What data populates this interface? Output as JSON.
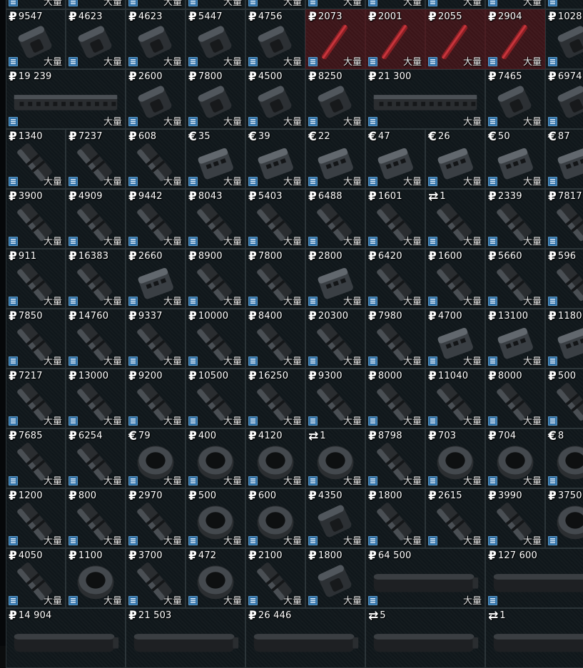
{
  "screen": {
    "title": "",
    "quantity_label": "大量"
  },
  "colors": {
    "cell_background": "#10171b",
    "cell_border": "#2b3438",
    "special_cell_background": "#3b1418",
    "tag_blue": "#2f6fa6",
    "text": "#ffffff"
  },
  "offers": [
    {
      "row": 0,
      "col": 0,
      "span": 1,
      "currency": "",
      "price": "",
      "icon": "tag",
      "art": "gear"
    },
    {
      "row": 0,
      "col": 1,
      "span": 1,
      "currency": "",
      "price": "",
      "icon": "tag",
      "art": "gear"
    },
    {
      "row": 0,
      "col": 2,
      "span": 1,
      "currency": "",
      "price": "",
      "icon": "tag",
      "art": "gear"
    },
    {
      "row": 0,
      "col": 3,
      "span": 1,
      "currency": "",
      "price": "",
      "icon": "tag",
      "art": "gear"
    },
    {
      "row": 0,
      "col": 4,
      "span": 1,
      "currency": "",
      "price": "",
      "icon": "tag",
      "art": "gear"
    },
    {
      "row": 0,
      "col": 5,
      "span": 1,
      "currency": "",
      "price": "",
      "icon": "tag",
      "art": "gear"
    },
    {
      "row": 0,
      "col": 6,
      "span": 1,
      "currency": "",
      "price": "",
      "icon": "tag",
      "art": "gear"
    },
    {
      "row": 0,
      "col": 7,
      "span": 1,
      "currency": "",
      "price": "",
      "icon": "tag",
      "art": "gear"
    },
    {
      "row": 0,
      "col": 8,
      "span": 1,
      "currency": "",
      "price": "",
      "icon": "tag",
      "art": "gear"
    },
    {
      "row": 0,
      "col": 9,
      "span": 1,
      "currency": "",
      "price": "",
      "icon": "tag",
      "art": "gear"
    },
    {
      "row": 1,
      "col": 0,
      "span": 1,
      "currency": "₽",
      "price": "9547",
      "icon": "tag",
      "art": "gear"
    },
    {
      "row": 1,
      "col": 1,
      "span": 1,
      "currency": "₽",
      "price": "4623",
      "icon": "tag",
      "art": "gear"
    },
    {
      "row": 1,
      "col": 2,
      "span": 1,
      "currency": "₽",
      "price": "4623",
      "icon": "tag",
      "art": "gear"
    },
    {
      "row": 1,
      "col": 3,
      "span": 1,
      "currency": "₽",
      "price": "5447",
      "icon": "tag",
      "art": "gear"
    },
    {
      "row": 1,
      "col": 4,
      "span": 1,
      "currency": "₽",
      "price": "4756",
      "icon": "tag",
      "art": "gear"
    },
    {
      "row": 1,
      "col": 5,
      "span": 1,
      "currency": "₽",
      "price": "2073",
      "icon": "tag",
      "art": "red",
      "variant": "red"
    },
    {
      "row": 1,
      "col": 6,
      "span": 1,
      "currency": "₽",
      "price": "2001",
      "icon": "tag",
      "art": "red",
      "variant": "red"
    },
    {
      "row": 1,
      "col": 7,
      "span": 1,
      "currency": "₽",
      "price": "2055",
      "icon": "tag",
      "art": "red",
      "variant": "red"
    },
    {
      "row": 1,
      "col": 8,
      "span": 1,
      "currency": "₽",
      "price": "2904",
      "icon": "tag",
      "art": "red",
      "variant": "red"
    },
    {
      "row": 1,
      "col": 9,
      "span": 1,
      "currency": "₽",
      "price": "1028",
      "icon": "tag",
      "art": "gear"
    },
    {
      "row": 2,
      "col": 0,
      "span": 2,
      "currency": "₽",
      "price": "19 239",
      "icon": "tag",
      "art": "handguard"
    },
    {
      "row": 2,
      "col": 2,
      "span": 1,
      "currency": "₽",
      "price": "2600",
      "icon": "tag",
      "art": "gear"
    },
    {
      "row": 2,
      "col": 3,
      "span": 1,
      "currency": "₽",
      "price": "7800",
      "icon": "tag",
      "art": "gear"
    },
    {
      "row": 2,
      "col": 4,
      "span": 1,
      "currency": "₽",
      "price": "4500",
      "icon": "tag",
      "art": "gear"
    },
    {
      "row": 2,
      "col": 5,
      "span": 1,
      "currency": "₽",
      "price": "8250",
      "icon": "tag",
      "art": "gear"
    },
    {
      "row": 2,
      "col": 6,
      "span": 2,
      "currency": "₽",
      "price": "21 300",
      "icon": "tag",
      "art": "handguard"
    },
    {
      "row": 2,
      "col": 8,
      "span": 1,
      "currency": "₽",
      "price": "7465",
      "icon": "tag",
      "art": "gear"
    },
    {
      "row": 2,
      "col": 9,
      "span": 1,
      "currency": "₽",
      "price": "6974",
      "icon": "tag",
      "art": "gear"
    },
    {
      "row": 3,
      "col": 0,
      "span": 1,
      "currency": "₽",
      "price": "1340",
      "icon": "tag",
      "art": "muzzle"
    },
    {
      "row": 3,
      "col": 1,
      "span": 1,
      "currency": "₽",
      "price": "7237",
      "icon": "tag",
      "art": "muzzle"
    },
    {
      "row": 3,
      "col": 2,
      "span": 1,
      "currency": "₽",
      "price": "608",
      "icon": "tag",
      "art": "muzzle"
    },
    {
      "row": 3,
      "col": 3,
      "span": 1,
      "currency": "€",
      "price": "35",
      "icon": "tag",
      "art": "comp"
    },
    {
      "row": 3,
      "col": 4,
      "span": 1,
      "currency": "€",
      "price": "39",
      "icon": "tag",
      "art": "comp"
    },
    {
      "row": 3,
      "col": 5,
      "span": 1,
      "currency": "€",
      "price": "22",
      "icon": "tag",
      "art": "comp"
    },
    {
      "row": 3,
      "col": 6,
      "span": 1,
      "currency": "€",
      "price": "47",
      "icon": "tag",
      "art": "comp"
    },
    {
      "row": 3,
      "col": 7,
      "span": 1,
      "currency": "€",
      "price": "26",
      "icon": "tag",
      "art": "comp"
    },
    {
      "row": 3,
      "col": 8,
      "span": 1,
      "currency": "€",
      "price": "50",
      "icon": "tag",
      "art": "comp"
    },
    {
      "row": 3,
      "col": 9,
      "span": 1,
      "currency": "€",
      "price": "87",
      "icon": "tag",
      "art": "comp"
    },
    {
      "row": 4,
      "col": 0,
      "span": 1,
      "currency": "₽",
      "price": "3900",
      "icon": "tag",
      "art": "muzzle"
    },
    {
      "row": 4,
      "col": 1,
      "span": 1,
      "currency": "₽",
      "price": "4909",
      "icon": "tag",
      "art": "muzzle"
    },
    {
      "row": 4,
      "col": 2,
      "span": 1,
      "currency": "₽",
      "price": "9442",
      "icon": "tag",
      "art": "muzzle"
    },
    {
      "row": 4,
      "col": 3,
      "span": 1,
      "currency": "₽",
      "price": "8043",
      "icon": "tag",
      "art": "muzzle"
    },
    {
      "row": 4,
      "col": 4,
      "span": 1,
      "currency": "₽",
      "price": "5403",
      "icon": "tag",
      "art": "muzzle"
    },
    {
      "row": 4,
      "col": 5,
      "span": 1,
      "currency": "₽",
      "price": "6488",
      "icon": "tag",
      "art": "muzzle"
    },
    {
      "row": 4,
      "col": 6,
      "span": 1,
      "currency": "₽",
      "price": "1601",
      "icon": "tag",
      "art": "muzzle"
    },
    {
      "row": 4,
      "col": 7,
      "span": 1,
      "currency": "⇄",
      "price": "1",
      "icon": "tag",
      "art": "muzzle"
    },
    {
      "row": 4,
      "col": 8,
      "span": 1,
      "currency": "₽",
      "price": "2339",
      "icon": "tag",
      "art": "muzzle"
    },
    {
      "row": 4,
      "col": 9,
      "span": 1,
      "currency": "₽",
      "price": "7817",
      "icon": "tag",
      "art": "muzzle"
    },
    {
      "row": 5,
      "col": 0,
      "span": 1,
      "currency": "₽",
      "price": "911",
      "icon": "tag",
      "art": "muzzle"
    },
    {
      "row": 5,
      "col": 1,
      "span": 1,
      "currency": "₽",
      "price": "16383",
      "icon": "tag",
      "art": "muzzle"
    },
    {
      "row": 5,
      "col": 2,
      "span": 1,
      "currency": "₽",
      "price": "2660",
      "icon": "tag",
      "art": "comp"
    },
    {
      "row": 5,
      "col": 3,
      "span": 1,
      "currency": "₽",
      "price": "8900",
      "icon": "tag",
      "art": "muzzle"
    },
    {
      "row": 5,
      "col": 4,
      "span": 1,
      "currency": "₽",
      "price": "7800",
      "icon": "tag",
      "art": "muzzle"
    },
    {
      "row": 5,
      "col": 5,
      "span": 1,
      "currency": "₽",
      "price": "2800",
      "icon": "tag",
      "art": "comp"
    },
    {
      "row": 5,
      "col": 6,
      "span": 1,
      "currency": "₽",
      "price": "6420",
      "icon": "tag",
      "art": "muzzle"
    },
    {
      "row": 5,
      "col": 7,
      "span": 1,
      "currency": "₽",
      "price": "1600",
      "icon": "tag",
      "art": "muzzle"
    },
    {
      "row": 5,
      "col": 8,
      "span": 1,
      "currency": "₽",
      "price": "5660",
      "icon": "tag",
      "art": "muzzle"
    },
    {
      "row": 5,
      "col": 9,
      "span": 1,
      "currency": "₽",
      "price": "596",
      "icon": "tag",
      "art": "muzzle"
    },
    {
      "row": 6,
      "col": 0,
      "span": 1,
      "currency": "₽",
      "price": "7850",
      "icon": "tag",
      "art": "muzzle"
    },
    {
      "row": 6,
      "col": 1,
      "span": 1,
      "currency": "₽",
      "price": "14760",
      "icon": "tag",
      "art": "muzzle"
    },
    {
      "row": 6,
      "col": 2,
      "span": 1,
      "currency": "₽",
      "price": "9337",
      "icon": "tag",
      "art": "muzzle"
    },
    {
      "row": 6,
      "col": 3,
      "span": 1,
      "currency": "₽",
      "price": "10000",
      "icon": "tag",
      "art": "muzzle"
    },
    {
      "row": 6,
      "col": 4,
      "span": 1,
      "currency": "₽",
      "price": "8400",
      "icon": "tag",
      "art": "muzzle"
    },
    {
      "row": 6,
      "col": 5,
      "span": 1,
      "currency": "₽",
      "price": "20300",
      "icon": "tag",
      "art": "muzzle"
    },
    {
      "row": 6,
      "col": 6,
      "span": 1,
      "currency": "₽",
      "price": "7980",
      "icon": "tag",
      "art": "muzzle"
    },
    {
      "row": 6,
      "col": 7,
      "span": 1,
      "currency": "₽",
      "price": "4700",
      "icon": "tag",
      "art": "comp"
    },
    {
      "row": 6,
      "col": 8,
      "span": 1,
      "currency": "₽",
      "price": "13100",
      "icon": "tag",
      "art": "comp"
    },
    {
      "row": 6,
      "col": 9,
      "span": 1,
      "currency": "₽",
      "price": "1180",
      "icon": "tag",
      "art": "comp"
    },
    {
      "row": 7,
      "col": 0,
      "span": 1,
      "currency": "₽",
      "price": "7217",
      "icon": "tag",
      "art": "muzzle"
    },
    {
      "row": 7,
      "col": 1,
      "span": 1,
      "currency": "₽",
      "price": "13000",
      "icon": "tag",
      "art": "muzzle"
    },
    {
      "row": 7,
      "col": 2,
      "span": 1,
      "currency": "₽",
      "price": "9200",
      "icon": "tag",
      "art": "muzzle"
    },
    {
      "row": 7,
      "col": 3,
      "span": 1,
      "currency": "₽",
      "price": "10500",
      "icon": "tag",
      "art": "muzzle"
    },
    {
      "row": 7,
      "col": 4,
      "span": 1,
      "currency": "₽",
      "price": "16250",
      "icon": "tag",
      "art": "muzzle"
    },
    {
      "row": 7,
      "col": 5,
      "span": 1,
      "currency": "₽",
      "price": "9300",
      "icon": "tag",
      "art": "muzzle"
    },
    {
      "row": 7,
      "col": 6,
      "span": 1,
      "currency": "₽",
      "price": "8000",
      "icon": "tag",
      "art": "muzzle"
    },
    {
      "row": 7,
      "col": 7,
      "span": 1,
      "currency": "₽",
      "price": "11040",
      "icon": "tag",
      "art": "muzzle"
    },
    {
      "row": 7,
      "col": 8,
      "span": 1,
      "currency": "₽",
      "price": "8000",
      "icon": "tag",
      "art": "muzzle"
    },
    {
      "row": 7,
      "col": 9,
      "span": 1,
      "currency": "₽",
      "price": "500",
      "icon": "tag",
      "art": "muzzle"
    },
    {
      "row": 8,
      "col": 0,
      "span": 1,
      "currency": "₽",
      "price": "7685",
      "icon": "tag",
      "art": "muzzle"
    },
    {
      "row": 8,
      "col": 1,
      "span": 1,
      "currency": "₽",
      "price": "6254",
      "icon": "tag",
      "art": "muzzle"
    },
    {
      "row": 8,
      "col": 2,
      "span": 1,
      "currency": "€",
      "price": "79",
      "icon": "tag",
      "art": "ring"
    },
    {
      "row": 8,
      "col": 3,
      "span": 1,
      "currency": "₽",
      "price": "400",
      "icon": "tag",
      "art": "ring"
    },
    {
      "row": 8,
      "col": 4,
      "span": 1,
      "currency": "₽",
      "price": "4120",
      "icon": "tag",
      "art": "ring"
    },
    {
      "row": 8,
      "col": 5,
      "span": 1,
      "currency": "⇄",
      "price": "1",
      "icon": "tag",
      "art": "ring"
    },
    {
      "row": 8,
      "col": 6,
      "span": 1,
      "currency": "₽",
      "price": "8798",
      "icon": "tag",
      "art": "muzzle"
    },
    {
      "row": 8,
      "col": 7,
      "span": 1,
      "currency": "₽",
      "price": "703",
      "icon": "tag",
      "art": "ring"
    },
    {
      "row": 8,
      "col": 8,
      "span": 1,
      "currency": "₽",
      "price": "704",
      "icon": "tag",
      "art": "ring"
    },
    {
      "row": 8,
      "col": 9,
      "span": 1,
      "currency": "€",
      "price": "8",
      "icon": "tag",
      "art": "ring"
    },
    {
      "row": 9,
      "col": 0,
      "span": 1,
      "currency": "₽",
      "price": "1200",
      "icon": "tag",
      "art": "muzzle"
    },
    {
      "row": 9,
      "col": 1,
      "span": 1,
      "currency": "₽",
      "price": "800",
      "icon": "tag",
      "art": "muzzle"
    },
    {
      "row": 9,
      "col": 2,
      "span": 1,
      "currency": "₽",
      "price": "2970",
      "icon": "tag",
      "art": "muzzle"
    },
    {
      "row": 9,
      "col": 3,
      "span": 1,
      "currency": "₽",
      "price": "500",
      "icon": "tag",
      "art": "ring"
    },
    {
      "row": 9,
      "col": 4,
      "span": 1,
      "currency": "₽",
      "price": "600",
      "icon": "tag",
      "art": "ring"
    },
    {
      "row": 9,
      "col": 5,
      "span": 1,
      "currency": "₽",
      "price": "4350",
      "icon": "tag",
      "art": "gear"
    },
    {
      "row": 9,
      "col": 6,
      "span": 1,
      "currency": "₽",
      "price": "1800",
      "icon": "tag",
      "art": "muzzle"
    },
    {
      "row": 9,
      "col": 7,
      "span": 1,
      "currency": "₽",
      "price": "2615",
      "icon": "tag",
      "art": "muzzle"
    },
    {
      "row": 9,
      "col": 8,
      "span": 1,
      "currency": "₽",
      "price": "3990",
      "icon": "tag",
      "art": "muzzle"
    },
    {
      "row": 9,
      "col": 9,
      "span": 1,
      "currency": "₽",
      "price": "3750",
      "icon": "tag",
      "art": "ring"
    },
    {
      "row": 10,
      "col": 0,
      "span": 1,
      "currency": "₽",
      "price": "4050",
      "icon": "tag",
      "art": "muzzle"
    },
    {
      "row": 10,
      "col": 1,
      "span": 1,
      "currency": "₽",
      "price": "1100",
      "icon": "tag",
      "art": "ring"
    },
    {
      "row": 10,
      "col": 2,
      "span": 1,
      "currency": "₽",
      "price": "3700",
      "icon": "tag",
      "art": "muzzle"
    },
    {
      "row": 10,
      "col": 3,
      "span": 1,
      "currency": "₽",
      "price": "472",
      "icon": "tag",
      "art": "ring"
    },
    {
      "row": 10,
      "col": 4,
      "span": 1,
      "currency": "₽",
      "price": "2100",
      "icon": "tag",
      "art": "muzzle"
    },
    {
      "row": 10,
      "col": 5,
      "span": 1,
      "currency": "₽",
      "price": "1800",
      "icon": "tag",
      "art": "gear"
    },
    {
      "row": 10,
      "col": 6,
      "span": 2,
      "currency": "₽",
      "price": "64 500",
      "icon": "tag",
      "art": "suppressor"
    },
    {
      "row": 10,
      "col": 8,
      "span": 2,
      "currency": "₽",
      "price": "127 600",
      "icon": "tag",
      "art": "suppressor"
    },
    {
      "row": 11,
      "col": 0,
      "span": 2,
      "currency": "₽",
      "price": "14 904",
      "icon": "",
      "art": "suppressor"
    },
    {
      "row": 11,
      "col": 2,
      "span": 2,
      "currency": "₽",
      "price": "21 503",
      "icon": "",
      "art": "suppressor"
    },
    {
      "row": 11,
      "col": 4,
      "span": 2,
      "currency": "₽",
      "price": "26 446",
      "icon": "",
      "art": "suppressor"
    },
    {
      "row": 11,
      "col": 6,
      "span": 2,
      "currency": "⇄",
      "price": "5",
      "icon": "",
      "art": "suppressor"
    },
    {
      "row": 11,
      "col": 8,
      "span": 2,
      "currency": "⇄",
      "price": "1",
      "icon": "",
      "art": "suppressor"
    }
  ]
}
